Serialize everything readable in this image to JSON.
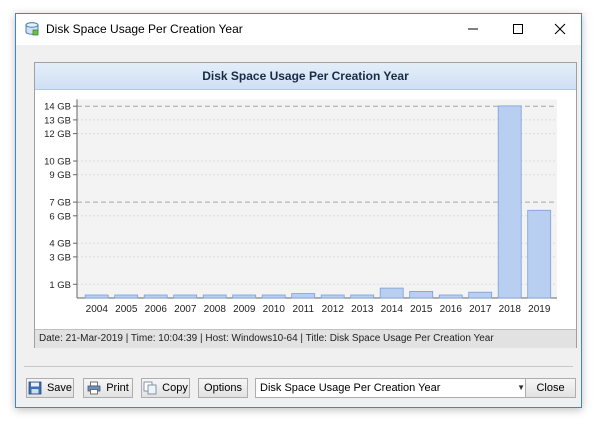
{
  "window": {
    "title": "Disk Space Usage Per Creation Year"
  },
  "chart_header": "Disk Space Usage Per Creation Year",
  "status_bar": "Date: 21-Mar-2019 | Time: 10:04:39 | Host: Windows10-64 | Title: Disk Space Usage Per Creation Year",
  "toolbar": {
    "save_label": "Save",
    "print_label": "Print",
    "copy_label": "Copy",
    "options_label": "Options",
    "report_select_value": "Disk Space Usage Per Creation Year",
    "close_label": "Close"
  },
  "colors": {
    "bar_fill": "#b9cff2",
    "bar_stroke": "#7b9fd6",
    "header_bg": "#d7e6f7",
    "window_border": "#3c87d2"
  },
  "chart_data": {
    "type": "bar",
    "title": "Disk Space Usage Per Creation Year",
    "categories": [
      "2004",
      "2005",
      "2006",
      "2007",
      "2008",
      "2009",
      "2010",
      "2011",
      "2012",
      "2013",
      "2014",
      "2015",
      "2016",
      "2017",
      "2018",
      "2019"
    ],
    "values": [
      0.22,
      0.22,
      0.22,
      0.22,
      0.22,
      0.22,
      0.22,
      0.32,
      0.22,
      0.22,
      0.72,
      0.48,
      0.22,
      0.42,
      14.02,
      6.4
    ],
    "unit": "GB",
    "ylim": [
      0,
      14.5
    ],
    "yticks": [
      1,
      3,
      4,
      6,
      7,
      9,
      10,
      12,
      13,
      14
    ],
    "ytick_labels": [
      "1 GB",
      "3 GB",
      "4 GB",
      "6 GB",
      "7 GB",
      "9 GB",
      "10 GB",
      "12 GB",
      "13 GB",
      "14 GB"
    ],
    "dashed_lines": [
      7,
      14
    ],
    "grid": true,
    "legend": "none"
  }
}
